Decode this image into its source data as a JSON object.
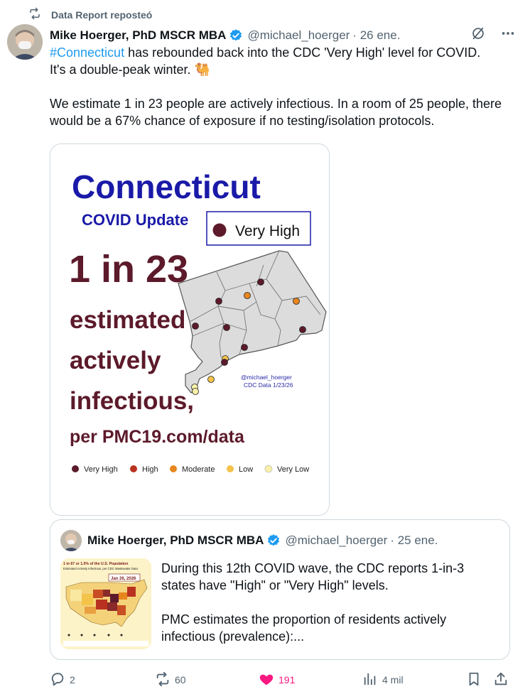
{
  "repost": {
    "label": "Data Report reposteó"
  },
  "post": {
    "author_name": "Mike Hoerger, PhD MSCR MBA",
    "handle": "@michael_hoerger",
    "date": "· 26 ene.",
    "hashtag": "#Connecticut",
    "line1_rest": " has rebounded back into the CDC 'Very High' level for COVID.",
    "line2": "It's a double-peak winter. 🐫",
    "para2": "We estimate 1 in 23 people are actively infectious. In a room of 25 people, there would be a 67% chance of exposure if no testing/isolation protocols."
  },
  "infographic": {
    "state": "Connecticut",
    "subtitle": "COVID Update",
    "legend_top": "Very High",
    "ratio": "1 in 23",
    "line1": "estimated",
    "line2": "actively",
    "line3": "infectious,",
    "source": "per PMC19.com/data",
    "credit1": "@michael_hoerger",
    "credit2": "CDC Data 1/23/26",
    "legend": [
      {
        "label": "Very High",
        "color": "#5c1a2b"
      },
      {
        "label": "High",
        "color": "#b8321f"
      },
      {
        "label": "Moderate",
        "color": "#e8861e"
      },
      {
        "label": "Low",
        "color": "#f3c34a"
      },
      {
        "label": "Very Low",
        "color": "#f8f0a8"
      }
    ]
  },
  "quote": {
    "author_name": "Mike Hoerger, PhD MSCR MBA",
    "handle": "@michael_hoerger",
    "date": "· 25 ene.",
    "para1": "During this 12th COVID wave, the CDC reports 1-in-3 states have \"High\" or \"Very High\" levels.",
    "para2": "PMC estimates the proportion of residents actively infectious (prevalence):...",
    "thumb_title1": "1 in 67 or 1.5% of the U.S. Population",
    "thumb_title2": "Estimated Actively Infectious, per CDC Wastewater Data",
    "thumb_date": "Jan 26, 2026"
  },
  "actions": {
    "replies": "2",
    "reposts": "60",
    "likes": "191",
    "views": "4 mil"
  },
  "colors": {
    "accent": "#1d9bf0",
    "like": "#f91880",
    "repost": "#00ba7c",
    "muted": "#536471",
    "dark_red": "#5c1a2b",
    "blue_title": "#1a1aa8"
  },
  "icons": [
    "repost-icon",
    "verified-icon",
    "grok-icon",
    "more-icon",
    "reply-icon",
    "heart-icon",
    "views-icon",
    "bookmark-icon",
    "share-icon"
  ]
}
